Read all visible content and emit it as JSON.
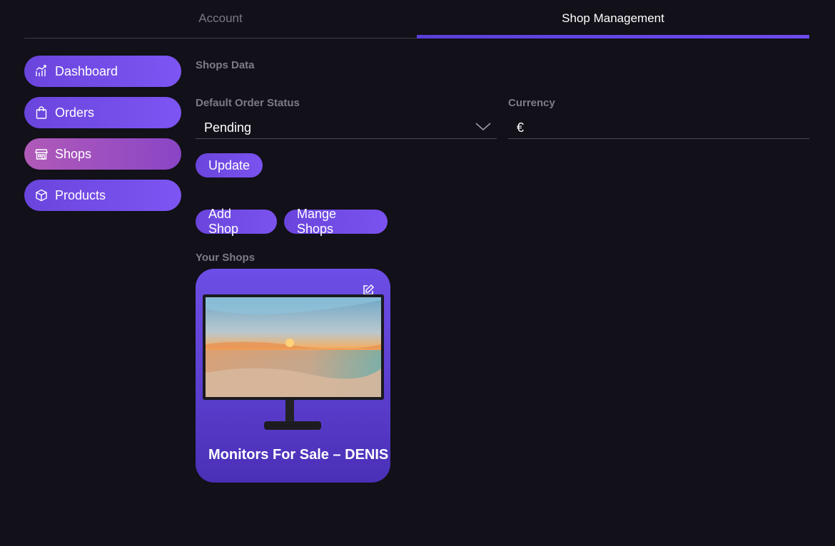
{
  "tabs": [
    {
      "label": "Account",
      "active": false
    },
    {
      "label": "Shop Management",
      "active": true
    }
  ],
  "sidebar": {
    "items": [
      {
        "label": "Dashboard",
        "icon": "chart-icon",
        "active": false
      },
      {
        "label": "Orders",
        "icon": "shopping-bag-icon",
        "active": false
      },
      {
        "label": "Shops",
        "icon": "store-icon",
        "active": true
      },
      {
        "label": "Products",
        "icon": "box-icon",
        "active": false
      }
    ]
  },
  "shops_data": {
    "title": "Shops Data",
    "default_order_status": {
      "label": "Default Order Status",
      "value": "Pending"
    },
    "currency": {
      "label": "Currency",
      "value": "€"
    },
    "update_label": "Update"
  },
  "actions": {
    "add_shop_label": "Add Shop",
    "manage_shops_label": "Mange Shops"
  },
  "your_shops": {
    "title": "Your Shops",
    "shops": [
      {
        "name": "Monitors For Sale – DENIS",
        "image": "monitor-sunset-image"
      }
    ]
  },
  "colors": {
    "background": "#121018",
    "accent": "#6d4cf0",
    "active_nav": "#b05ab8",
    "muted_text": "#7d7b86"
  }
}
